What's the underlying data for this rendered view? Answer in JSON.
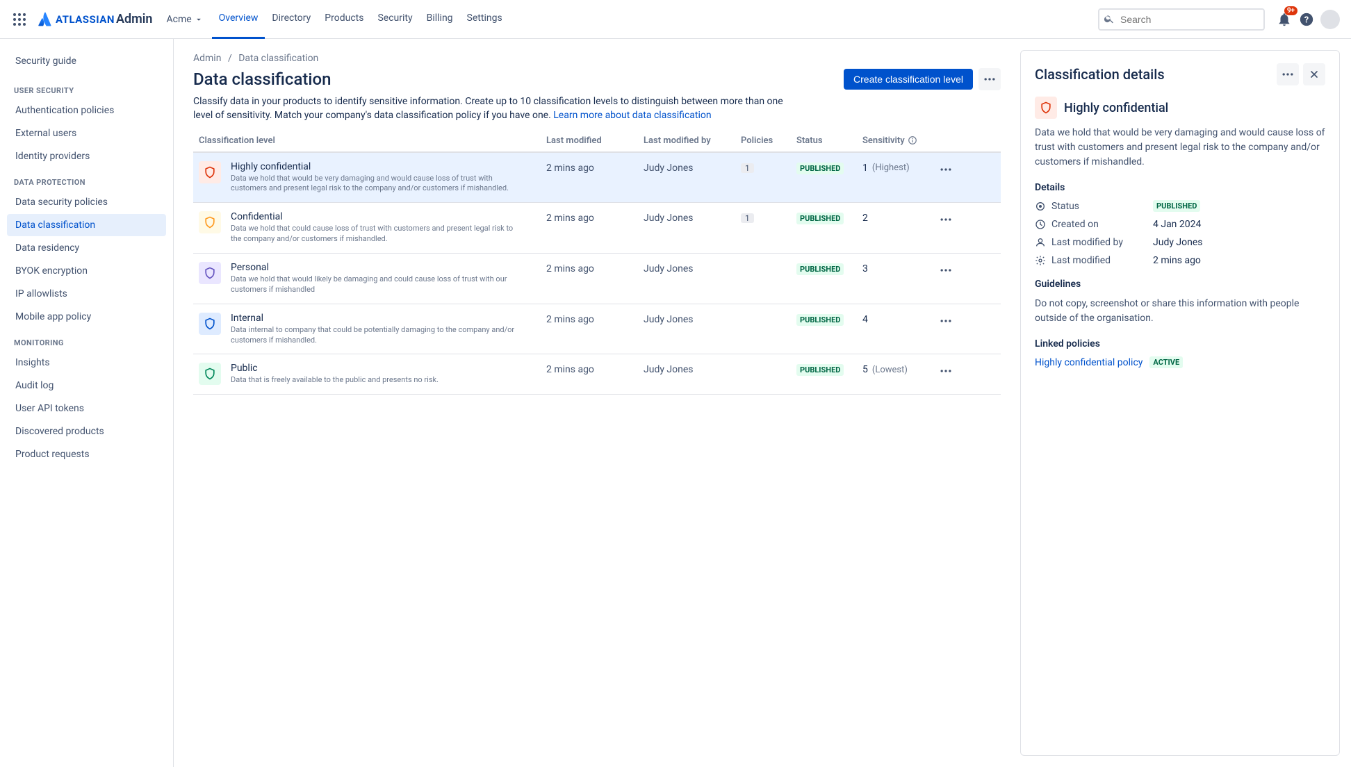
{
  "brand": {
    "name": "ATLASSIAN",
    "product": "Admin"
  },
  "org": "Acme",
  "topnav": [
    "Overview",
    "Directory",
    "Products",
    "Security",
    "Billing",
    "Settings"
  ],
  "topnav_active": 0,
  "search": {
    "placeholder": "Search"
  },
  "notif_badge": "9+",
  "sidebar": {
    "top": "Security guide",
    "groups": [
      {
        "title": "USER SECURITY",
        "items": [
          "Authentication policies",
          "External users",
          "Identity providers"
        ]
      },
      {
        "title": "DATA PROTECTION",
        "items": [
          "Data security policies",
          "Data classification",
          "Data residency",
          "BYOK encryption",
          "IP allowlists",
          "Mobile app policy"
        ],
        "active": 1
      },
      {
        "title": "MONITORING",
        "items": [
          "Insights",
          "Audit log",
          "User API tokens",
          "Discovered products",
          "Product requests"
        ]
      }
    ]
  },
  "breadcrumb": {
    "root": "Admin",
    "current": "Data classification"
  },
  "page": {
    "title": "Data classification",
    "create_btn": "Create classification level",
    "desc": "Classify data in your products to identify sensitive information. Create up to 10 classification levels to distinguish between more than one level of sensitivity. Match your company's data classification policy if you have one. ",
    "learn_more": "Learn more about data classification"
  },
  "columns": {
    "level": "Classification level",
    "modified": "Last modified",
    "by": "Last modified by",
    "policies": "Policies",
    "status": "Status",
    "sensitivity": "Sensitivity"
  },
  "rows": [
    {
      "name": "Highly confidential",
      "desc": "Data we hold that would be very damaging and would cause loss of trust with customers and present legal risk to the company and/or customers if mishandled.",
      "modified": "2 mins ago",
      "by": "Judy Jones",
      "policies": "1",
      "status": "PUBLISHED",
      "sens": "1",
      "qual": "(Highest)",
      "iconBg": "#FFEBE6",
      "iconFg": "#DE350B",
      "selected": true
    },
    {
      "name": "Confidential",
      "desc": "Data we hold that could cause loss of trust with customers and present legal risk to the company and/or customers if mishandled.",
      "modified": "2 mins ago",
      "by": "Judy Jones",
      "policies": "1",
      "status": "PUBLISHED",
      "sens": "2",
      "qual": "",
      "iconBg": "#FFFAE6",
      "iconFg": "#FF991F"
    },
    {
      "name": "Personal",
      "desc": "Data we hold that would likely be damaging and could cause loss of trust with our customers if mishandled",
      "modified": "2 mins ago",
      "by": "Judy Jones",
      "policies": "",
      "status": "PUBLISHED",
      "sens": "3",
      "qual": "",
      "iconBg": "#EAE6FF",
      "iconFg": "#6554C0"
    },
    {
      "name": "Internal",
      "desc": "Data internal to company that could be potentially damaging to the company and/or customers if mishandled.",
      "modified": "2 mins ago",
      "by": "Judy Jones",
      "policies": "",
      "status": "PUBLISHED",
      "sens": "4",
      "qual": "",
      "iconBg": "#DEEBFF",
      "iconFg": "#0052CC"
    },
    {
      "name": "Public",
      "desc": "Data that is freely available to the public and presents no risk.",
      "modified": "2 mins ago",
      "by": "Judy Jones",
      "policies": "",
      "status": "PUBLISHED",
      "sens": "5",
      "qual": "(Lowest)",
      "iconBg": "#E3FCEF",
      "iconFg": "#00875A"
    }
  ],
  "detail": {
    "title": "Classification details",
    "name": "Highly confidential",
    "desc": "Data we hold that would be very damaging and would cause loss of trust with customers and present legal risk to the company and/or customers if mishandled.",
    "iconBg": "#FFEBE6",
    "iconFg": "#DE350B",
    "details_heading": "Details",
    "meta": {
      "status_label": "Status",
      "status": "PUBLISHED",
      "created_label": "Created on",
      "created": "4 Jan 2024",
      "by_label": "Last modified by",
      "by": "Judy Jones",
      "mod_label": "Last modified",
      "mod": "2 mins ago"
    },
    "guidelines_heading": "Guidelines",
    "guidelines": "Do not copy, screenshot or share this information with people outside of the organisation.",
    "linked_heading": "Linked policies",
    "linked_policy": "Highly confidential policy",
    "linked_status": "ACTIVE"
  }
}
